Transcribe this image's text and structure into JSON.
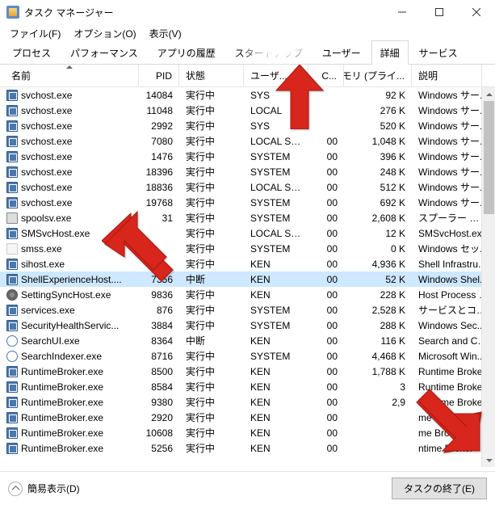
{
  "window": {
    "title": "タスク マネージャー"
  },
  "menu": {
    "file": "ファイル(F)",
    "options": "オプション(O)",
    "view": "表示(V)"
  },
  "tabs": {
    "processes": "プロセス",
    "performance": "パフォーマンス",
    "apphistory": "アプリの履歴",
    "startup": "スタートアップ",
    "users": "ユーザー",
    "details": "詳細",
    "services": "サービス"
  },
  "columns": {
    "name": "名前",
    "pid": "PID",
    "status": "状態",
    "user": "ユーザ...",
    "cpu": "C...",
    "memory": "メモリ (プライ...",
    "description": "説明"
  },
  "footer": {
    "simple": "簡易表示(D)",
    "endtask": "タスクの終了(E)"
  },
  "rows": [
    {
      "ico": "svc",
      "name": "svchost.exe",
      "pid": "14084",
      "status": "実行中",
      "user": "SYS",
      "cpu": "",
      "mem": "92 K",
      "desc": "Windows サー..."
    },
    {
      "ico": "svc",
      "name": "svchost.exe",
      "pid": "11048",
      "status": "実行中",
      "user": "LOCAL",
      "cpu": "",
      "mem": "276 K",
      "desc": "Windows サー..."
    },
    {
      "ico": "svc",
      "name": "svchost.exe",
      "pid": "2992",
      "status": "実行中",
      "user": "SYS",
      "cpu": "",
      "mem": "520 K",
      "desc": "Windows サー..."
    },
    {
      "ico": "svc",
      "name": "svchost.exe",
      "pid": "7080",
      "status": "実行中",
      "user": "LOCAL SE...",
      "cpu": "00",
      "mem": "1,048 K",
      "desc": "Windows サー..."
    },
    {
      "ico": "svc",
      "name": "svchost.exe",
      "pid": "1476",
      "status": "実行中",
      "user": "SYSTEM",
      "cpu": "00",
      "mem": "396 K",
      "desc": "Windows サー..."
    },
    {
      "ico": "svc",
      "name": "svchost.exe",
      "pid": "18396",
      "status": "実行中",
      "user": "SYSTEM",
      "cpu": "00",
      "mem": "248 K",
      "desc": "Windows サー..."
    },
    {
      "ico": "svc",
      "name": "svchost.exe",
      "pid": "18836",
      "status": "実行中",
      "user": "LOCAL SE...",
      "cpu": "00",
      "mem": "512 K",
      "desc": "Windows サー..."
    },
    {
      "ico": "svc",
      "name": "svchost.exe",
      "pid": "19768",
      "status": "実行中",
      "user": "SYSTEM",
      "cpu": "00",
      "mem": "692 K",
      "desc": "Windows サー..."
    },
    {
      "ico": "print",
      "name": "spoolsv.exe",
      "pid": "31",
      "status": "実行中",
      "user": "SYSTEM",
      "cpu": "00",
      "mem": "2,608 K",
      "desc": "スプーラー サブシ..."
    },
    {
      "ico": "svc",
      "name": "SMSvcHost.exe",
      "pid": "",
      "status": "実行中",
      "user": "LOCAL SE...",
      "cpu": "00",
      "mem": "12 K",
      "desc": "SMSvcHost.exe"
    },
    {
      "ico": "blank",
      "name": "smss.exe",
      "pid": "",
      "status": "実行中",
      "user": "SYSTEM",
      "cpu": "00",
      "mem": "0 K",
      "desc": "Windows セッ..."
    },
    {
      "ico": "svc",
      "name": "sihost.exe",
      "pid": "",
      "status": "実行中",
      "user": "KEN",
      "cpu": "00",
      "mem": "4,936 K",
      "desc": "Shell Infrastru..."
    },
    {
      "ico": "svc",
      "name": "ShellExperienceHost....",
      "pid": "7356",
      "status": "中断",
      "user": "KEN",
      "cpu": "00",
      "mem": "52 K",
      "desc": "Windows Shel...",
      "selected": true
    },
    {
      "ico": "gear",
      "name": "SettingSyncHost.exe",
      "pid": "9836",
      "status": "実行中",
      "user": "KEN",
      "cpu": "00",
      "mem": "228 K",
      "desc": "Host Process f..."
    },
    {
      "ico": "svc",
      "name": "services.exe",
      "pid": "876",
      "status": "実行中",
      "user": "SYSTEM",
      "cpu": "00",
      "mem": "2,528 K",
      "desc": "サービスとコント..."
    },
    {
      "ico": "svc",
      "name": "SecurityHealthServic...",
      "pid": "3884",
      "status": "実行中",
      "user": "SYSTEM",
      "cpu": "00",
      "mem": "288 K",
      "desc": "Windows Sec..."
    },
    {
      "ico": "mag",
      "name": "SearchUI.exe",
      "pid": "8364",
      "status": "中断",
      "user": "KEN",
      "cpu": "00",
      "mem": "116 K",
      "desc": "Search and Co..."
    },
    {
      "ico": "mag",
      "name": "SearchIndexer.exe",
      "pid": "8716",
      "status": "実行中",
      "user": "SYSTEM",
      "cpu": "00",
      "mem": "4,468 K",
      "desc": "Microsoft Win..."
    },
    {
      "ico": "svc",
      "name": "RuntimeBroker.exe",
      "pid": "8500",
      "status": "実行中",
      "user": "KEN",
      "cpu": "00",
      "mem": "1,788 K",
      "desc": "Runtime Broker"
    },
    {
      "ico": "svc",
      "name": "RuntimeBroker.exe",
      "pid": "8584",
      "status": "実行中",
      "user": "KEN",
      "cpu": "00",
      "mem": "3",
      "desc": "Runtime Broker"
    },
    {
      "ico": "svc",
      "name": "RuntimeBroker.exe",
      "pid": "9380",
      "status": "実行中",
      "user": "KEN",
      "cpu": "00",
      "mem": "2,9",
      "desc": "Runtime Broker"
    },
    {
      "ico": "svc",
      "name": "RuntimeBroker.exe",
      "pid": "2920",
      "status": "実行中",
      "user": "KEN",
      "cpu": "00",
      "mem": "",
      "desc": "me Broker"
    },
    {
      "ico": "svc",
      "name": "RuntimeBroker.exe",
      "pid": "10608",
      "status": "実行中",
      "user": "KEN",
      "cpu": "00",
      "mem": "",
      "desc": "me Broker"
    },
    {
      "ico": "svc",
      "name": "RuntimeBroker.exe",
      "pid": "5256",
      "status": "実行中",
      "user": "KEN",
      "cpu": "00",
      "mem": "",
      "desc": "ntime Broker"
    }
  ]
}
